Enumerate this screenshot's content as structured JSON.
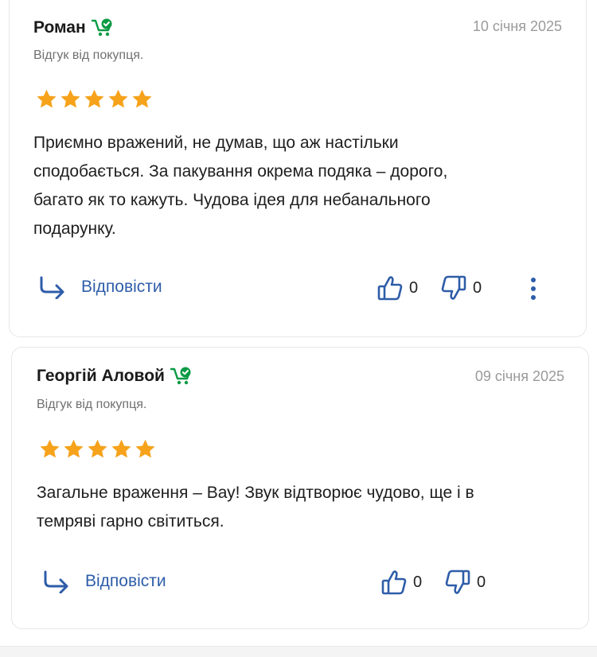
{
  "reviews": [
    {
      "author": "Роман",
      "date": "10 січня 2025",
      "subtitle": "Відгук від покупця.",
      "rating": 5,
      "lines": [
        "Приємно вражений, не думав, що аж настільки",
        "сподобається. За пакування окрема подяка – дорого,",
        "багато як то кажуть. Чудова ідея для небанального",
        "подарунку."
      ],
      "reply_label": "Відповісти",
      "likes": "0",
      "dislikes": "0"
    },
    {
      "author": "Георгій Аловой",
      "date": "09 січня 2025",
      "subtitle": "Відгук від покупця.",
      "rating": 5,
      "lines": [
        "Загальне враження – Вау! Звук відтворює чудово, ще і в",
        "темряві гарно світиться."
      ],
      "reply_label": "Відповісти",
      "likes": "0",
      "dislikes": "0"
    }
  ],
  "icons": {
    "buyer": "verified-buyer-cart-icon",
    "star": "star-icon",
    "reply": "reply-arrow-icon",
    "like": "thumbs-up-icon",
    "dislike": "thumbs-down-icon",
    "more": "more-vertical-icon"
  },
  "colors": {
    "star": "#f6a21a",
    "accent": "#2e5da8",
    "buyer_green": "#0a9a44",
    "muted": "#9a9a9a"
  }
}
